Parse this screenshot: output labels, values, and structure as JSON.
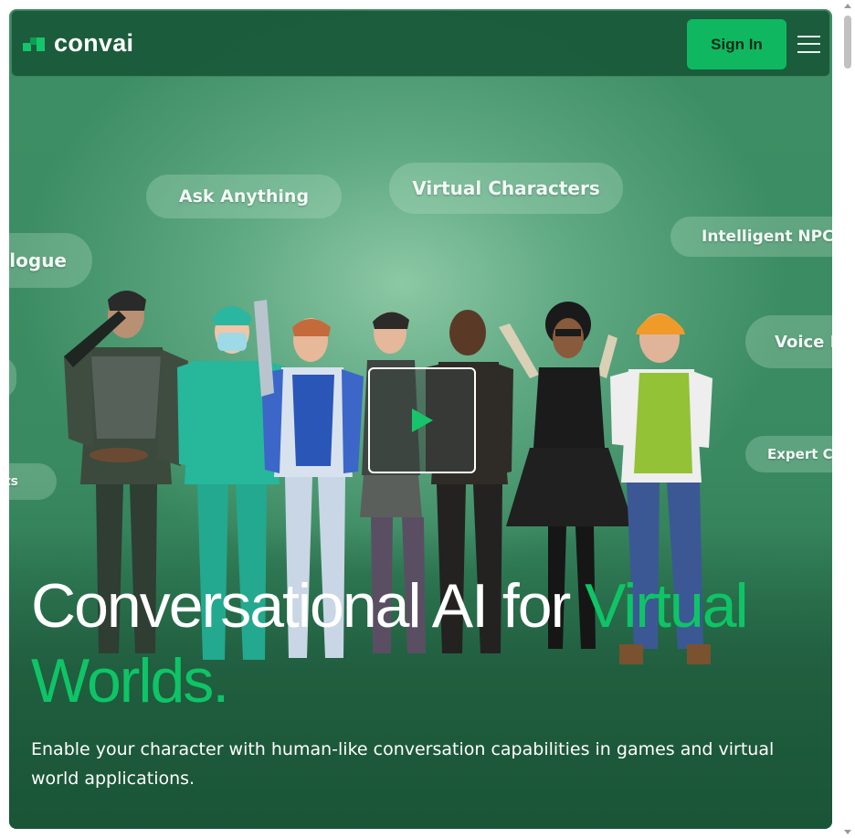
{
  "brand": {
    "name": "convai",
    "accent": "#0fc466",
    "button_color": "#0fb860"
  },
  "nav": {
    "signin_label": "Sign In",
    "menu_icon": "hamburger-menu-icon"
  },
  "pills": [
    {
      "id": "ask",
      "label": "Ask Anything"
    },
    {
      "id": "virtual",
      "label": "Virtual Characters"
    },
    {
      "id": "npc",
      "label": "Intelligent NPC"
    },
    {
      "id": "dialogue",
      "label": "alogue"
    },
    {
      "id": "voice",
      "label": "Voice B"
    },
    {
      "id": "expert",
      "label": "Expert Ch"
    },
    {
      "id": "ts",
      "label": "ts"
    }
  ],
  "video": {
    "icon": "play-icon"
  },
  "hero": {
    "headline_part1": "Conversational AI for ",
    "headline_accent": "Virtual Worlds.",
    "subtitle": "Enable your character with human-like conversation capabilities in games and virtual world applications."
  }
}
